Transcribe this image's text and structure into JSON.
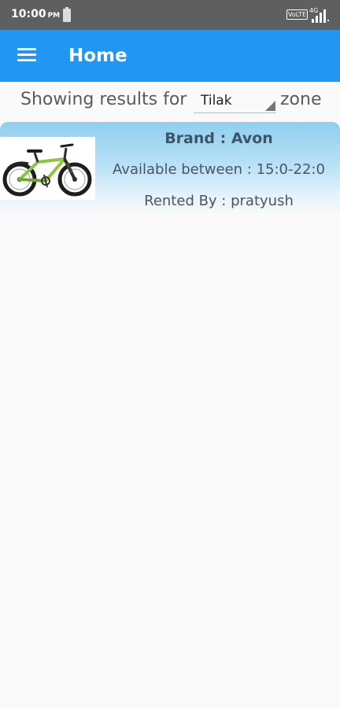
{
  "status_bar": {
    "time": "10:00",
    "ampm": "PM",
    "network_badge": "VoLTE",
    "network_type": "4G"
  },
  "app_bar": {
    "title": "Home",
    "color": "#2196f3"
  },
  "filter": {
    "prefix": "Showing results for",
    "selected_zone": "Tilak",
    "suffix": "zone"
  },
  "listings": [
    {
      "brand": "Brand : Avon",
      "availability": "Available between : 15:0-22:0",
      "rented_by": "Rented By : pratyush",
      "image": "bicycle-image"
    }
  ]
}
